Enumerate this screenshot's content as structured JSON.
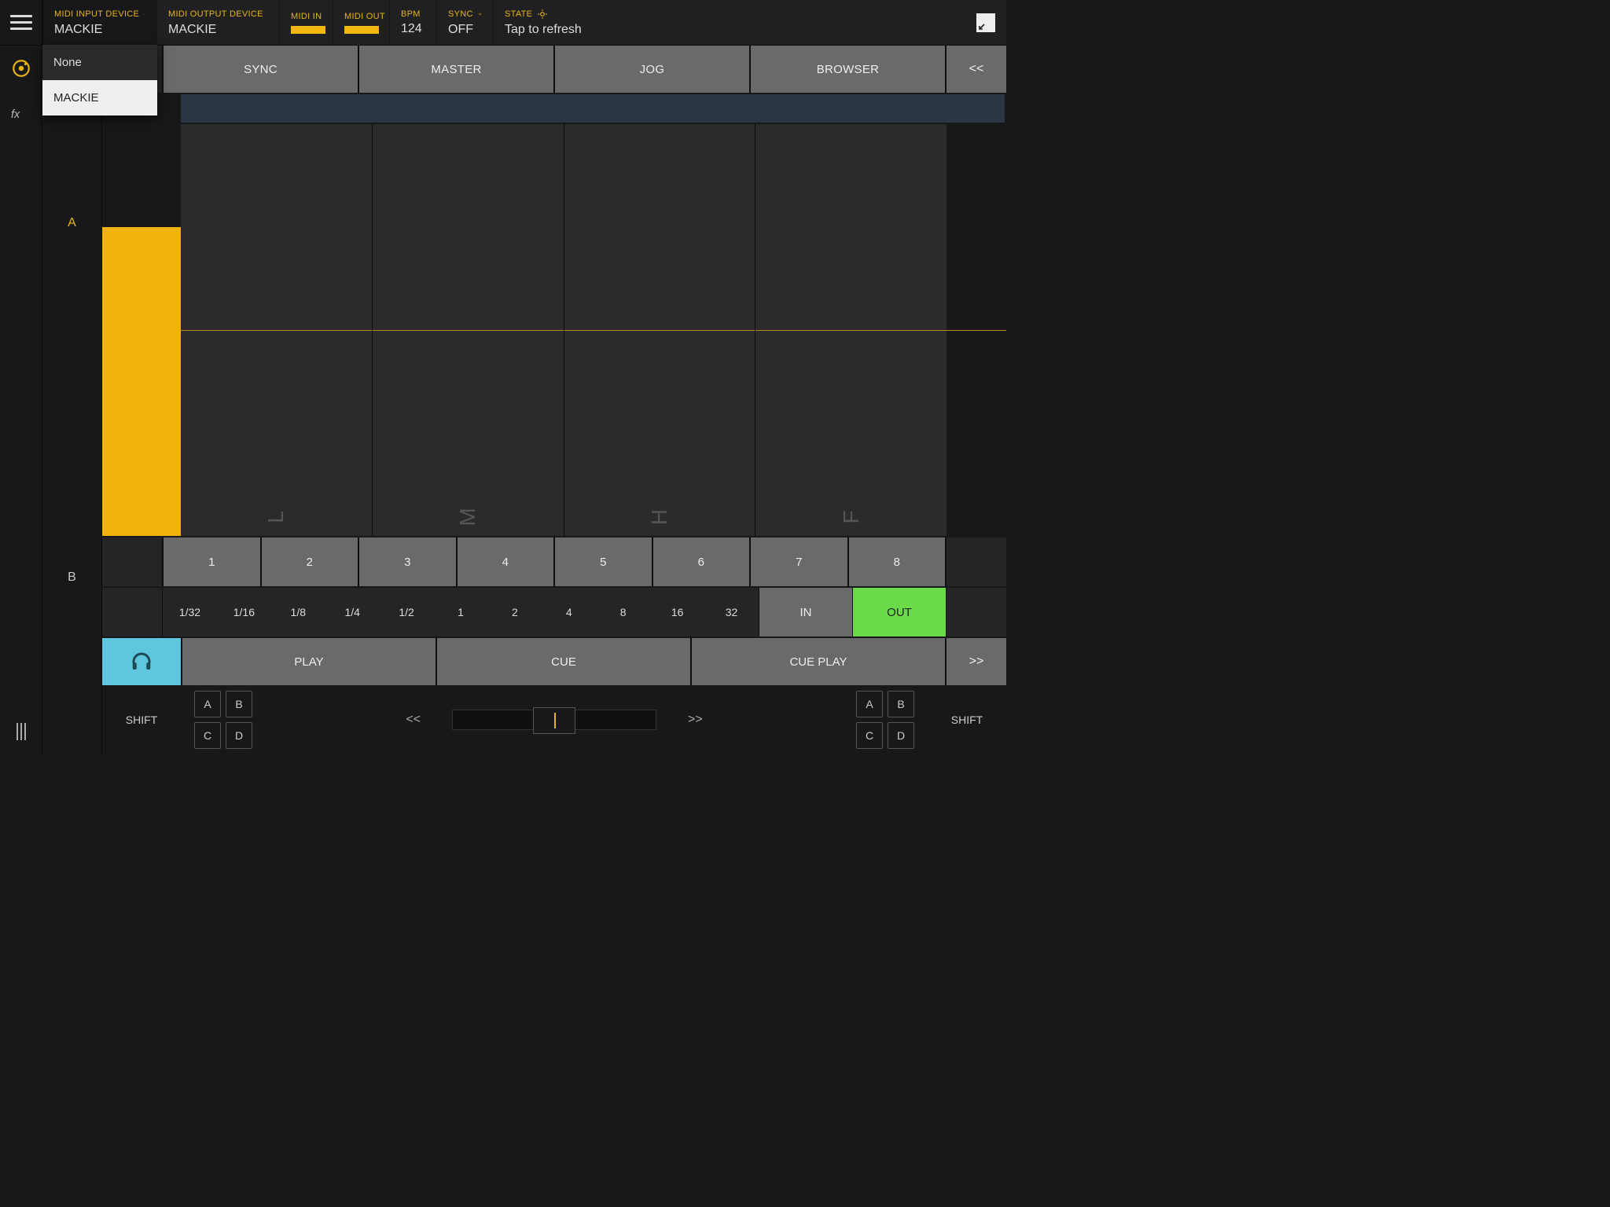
{
  "header": {
    "midi_input": {
      "label": "MIDI INPUT DEVICE",
      "value": "MACKIE"
    },
    "midi_output": {
      "label": "MIDI OUTPUT DEVICE",
      "value": "MACKIE"
    },
    "midi_in": {
      "label": "MIDI IN"
    },
    "midi_out": {
      "label": "MIDI OUT"
    },
    "bpm": {
      "label": "BPM",
      "value": "124"
    },
    "sync": {
      "label": "SYNC",
      "value": "OFF"
    },
    "state": {
      "label": "STATE",
      "value": "Tap to refresh"
    }
  },
  "dropdown": {
    "options": [
      "None",
      "MACKIE"
    ],
    "selected": "MACKIE"
  },
  "decks": {
    "a": "A",
    "b": "B"
  },
  "tabs": [
    "SYNC",
    "MASTER",
    "JOG",
    "BROWSER"
  ],
  "nav": {
    "back": "<<",
    "fwd": ">>"
  },
  "pad_letters": [
    "L",
    "M",
    "H",
    "F"
  ],
  "numbers": [
    "1",
    "2",
    "3",
    "4",
    "5",
    "6",
    "7",
    "8"
  ],
  "beats": [
    "1/32",
    "1/16",
    "1/8",
    "1/4",
    "1/2",
    "1",
    "2",
    "4",
    "8",
    "16",
    "32"
  ],
  "loop": {
    "in": "IN",
    "out": "OUT"
  },
  "transport": [
    "PLAY",
    "CUE",
    "CUE PLAY"
  ],
  "shift": "SHIFT",
  "abcd": [
    "A",
    "B",
    "C",
    "D"
  ],
  "slider_nav": {
    "back": "<<",
    "fwd": ">>"
  }
}
